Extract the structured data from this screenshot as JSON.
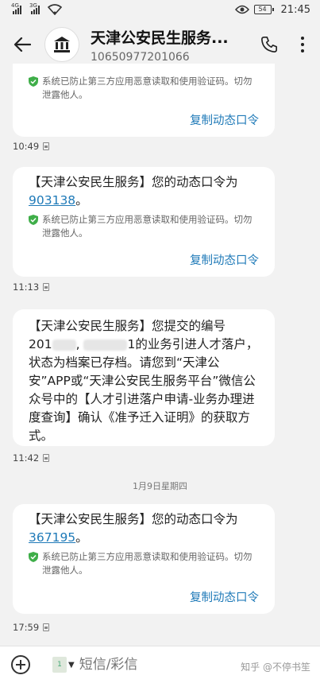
{
  "status_bar": {
    "signal1_tag": "4G",
    "signal2_tag": "3G",
    "battery": "54",
    "time": "21:45"
  },
  "header": {
    "title": "天津公安民生服务...",
    "number": "10650977201066"
  },
  "notice_text": "系统已防止第三方应用恶意读取和使用验证码。切勿泄露他人。",
  "copy_label": "复制动态口令",
  "messages": [
    {
      "time": "10:49"
    },
    {
      "body_prefix": "【天津公安民生服务】您的动态口令为",
      "otp": "903138",
      "body_suffix": "。",
      "time": "11:13"
    },
    {
      "body_line1": "【天津公安民生服务】您提交的编号",
      "body_line2_start": "201",
      "body_line2_mid": "1",
      "body_line2_end": "的业务引进人才",
      "body_rest": "落户，状态为档案已存档。请您到“天津公安”APP或“天津公安民生服务平台”微信公众号中的【人才引进落户申请-业务办理进度查询】确认《准予迁入证明》的获取方式。",
      "time": "11:42"
    },
    {
      "body_prefix": "【天津公安民生服务】您的动态口令为",
      "otp": "367195",
      "body_suffix": "。",
      "time": "17:59"
    }
  ],
  "date_separator": "1月9日星期四",
  "input": {
    "sim_label": "1",
    "placeholder": "短信/彩信"
  },
  "watermark": "知乎 @不停书笙"
}
